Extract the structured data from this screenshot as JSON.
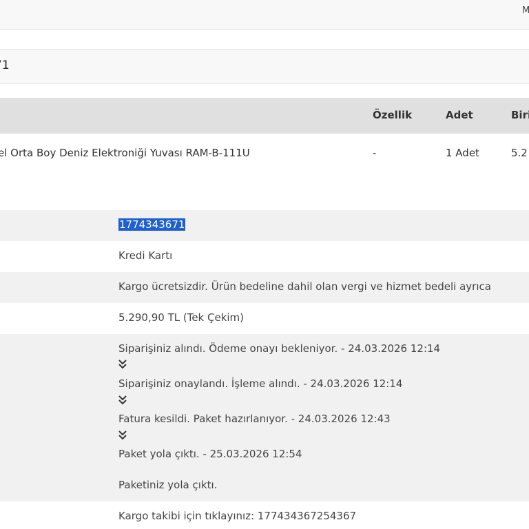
{
  "header": {
    "right_text": "M"
  },
  "order": {
    "number_partial": "71"
  },
  "table": {
    "headers": {
      "ozellik": "Özellik",
      "adet": "Adet",
      "birim": "Biri"
    },
    "row": {
      "product": "el Orta Boy Deniz Elektroniği Yuvası RAM-B-111U",
      "ozellik": "-",
      "adet": "1 Adet",
      "birim": "5.2"
    }
  },
  "details": {
    "order_code": "1774343671",
    "payment": "Kredi Kartı",
    "shipping_note": "Kargo ücretsizdir. Ürün bedeline dahil olan vergi ve hizmet bedeli ayrıca",
    "total": "5.290,90 TL (Tek Çekim)",
    "status": [
      "Siparişiniz alındı. Ödeme onayı bekleniyor. - 24.03.2026 12:14",
      "Siparişiniz onaylandı. İşleme alındı. - 24.03.2026 12:14",
      "Fatura kesildi. Paket hazırlanıyor. - 24.03.2026 12:43",
      "Paket yola çıktı. - 25.03.2026 12:54"
    ],
    "status_note": "Paketiniz yola çıktı.",
    "tracking": "Kargo takibi için tıklayınız: 177434367254367"
  },
  "icons": {
    "chevron": "double-chevron-down-icon"
  }
}
